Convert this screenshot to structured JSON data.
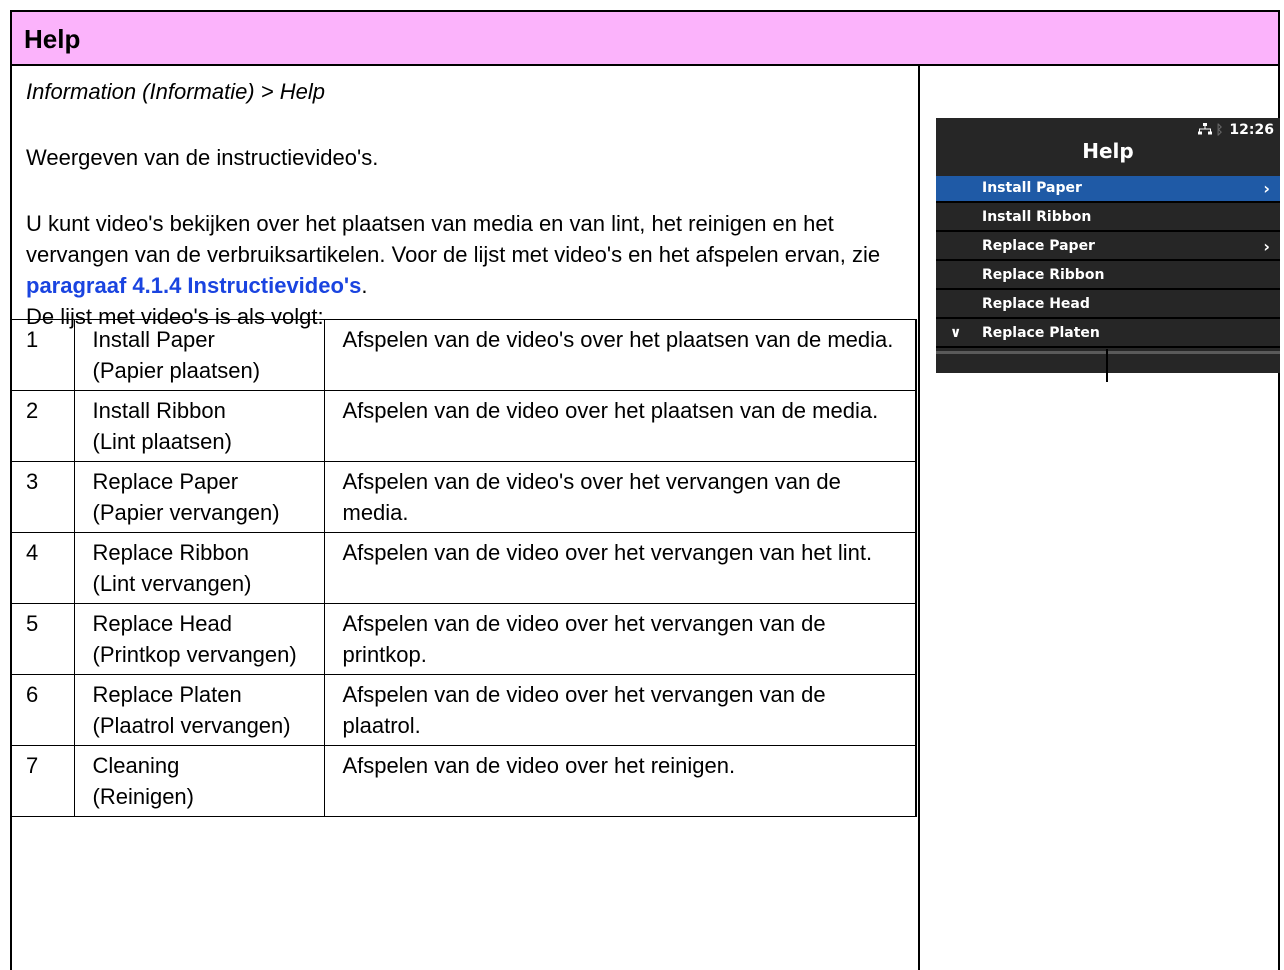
{
  "header": {
    "title": "Help"
  },
  "breadcrumb": "Information (Informatie) > Help",
  "summary": "Weergeven van de instructievideo's.",
  "description": {
    "text_before": "U kunt video's bekijken over het plaatsen van media en van lint, het reinigen en het vervangen van de verbruiksartikelen. Voor de lijst met video's en het afspelen ervan, zie ",
    "link": "paragraaf 4.1.4 Instructievideo's",
    "text_after": ".",
    "list_intro": "De lijst met video's is als volgt:"
  },
  "table": {
    "rows": [
      {
        "num": "1",
        "name": "Install Paper",
        "name_nl": "(Papier plaatsen)",
        "desc": "Afspelen van de video's over het plaatsen van de media."
      },
      {
        "num": "2",
        "name": "Install Ribbon",
        "name_nl": "(Lint plaatsen)",
        "desc": "Afspelen van de video over het plaatsen van de media."
      },
      {
        "num": "3",
        "name": "Replace Paper",
        "name_nl": "(Papier vervangen)",
        "desc": "Afspelen van de video's over het vervangen van de media."
      },
      {
        "num": "4",
        "name": "Replace Ribbon",
        "name_nl": "(Lint vervangen)",
        "desc": "Afspelen van de video over het vervangen van het lint."
      },
      {
        "num": "5",
        "name": "Replace Head",
        "name_nl": "(Printkop vervangen)",
        "desc": "Afspelen van de video over het vervangen van de printkop."
      },
      {
        "num": "6",
        "name": "Replace Platen",
        "name_nl": "(Plaatrol vervangen)",
        "desc": "Afspelen van de video over het vervangen van de plaatrol."
      },
      {
        "num": "7",
        "name": "Cleaning",
        "name_nl": "(Reinigen)",
        "desc": "Afspelen van de video over het reinigen."
      }
    ]
  },
  "screen": {
    "time": "12:26",
    "title": "Help",
    "menu_items": [
      {
        "label": "Install Paper",
        "selected": true,
        "chevron": "right"
      },
      {
        "label": "Install Ribbon",
        "selected": false,
        "chevron": ""
      },
      {
        "label": "Replace Paper",
        "selected": false,
        "chevron": "right"
      },
      {
        "label": "Replace Ribbon",
        "selected": false,
        "chevron": ""
      },
      {
        "label": "Replace Head",
        "selected": false,
        "chevron": ""
      },
      {
        "label": "Replace Platen",
        "selected": false,
        "chevron": "down"
      }
    ],
    "colors": {
      "background": "#262626",
      "selected": "#1f5aa6"
    }
  },
  "colors": {
    "header_bg": "#fbb3fb",
    "link": "#1a44e0"
  }
}
